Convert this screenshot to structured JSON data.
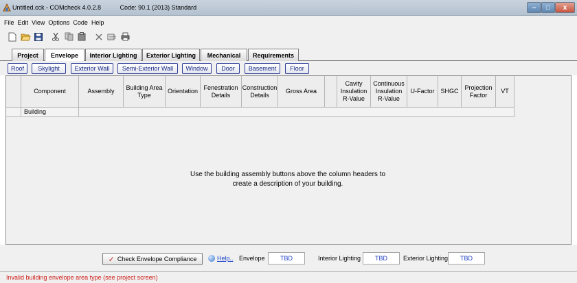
{
  "window": {
    "title": "Untitled.cck - COMcheck 4.0.2.8",
    "code_label": "Code: 90.1 (2013) Standard",
    "minimize_glyph": "–",
    "maximize_glyph": "□",
    "close_glyph": "x"
  },
  "menu": [
    "File",
    "Edit",
    "View",
    "Options",
    "Code",
    "Help"
  ],
  "toolbar": [
    "new-icon",
    "open-icon",
    "save-icon",
    "cut-icon",
    "copy-icon",
    "paste-icon",
    "delete-icon",
    "edit-icon",
    "print-icon"
  ],
  "tabs": [
    "Project",
    "Envelope",
    "Interior Lighting",
    "Exterior Lighting",
    "Mechanical",
    "Requirements"
  ],
  "active_tab": "Envelope",
  "assembly_buttons": [
    "Roof",
    "Skylight",
    "Exterior Wall",
    "Semi-Exterior Wall",
    "Window",
    "Door",
    "Basement",
    "Floor"
  ],
  "table": {
    "headers": [
      "",
      "Component",
      "Assembly",
      "Building Area Type",
      "Orientation",
      "Fenestration Details",
      "Construction Details",
      "Gross Area",
      "",
      "Cavity Insulation R-Value",
      "Continuous Insulation R-Value",
      "U-Factor",
      "SHGC",
      "Projection Factor",
      "VT"
    ],
    "rows": [
      [
        "",
        "Building"
      ]
    ],
    "empty_message": "Use the building assembly buttons above the column headers to create a description of your building."
  },
  "compliance": {
    "check_button": "Check Envelope Compliance",
    "help_link": "Help..",
    "envelope_label": "Envelope",
    "envelope_value": "TBD",
    "interior_label": "Interior Lighting",
    "interior_value": "TBD",
    "exterior_label": "Exterior Lighting",
    "exterior_value": "TBD"
  },
  "status": "Invalid building envelope area type (see project screen)",
  "colors": {
    "status_error": "#d0201a",
    "link": "#1a44c9",
    "assembly_text": "#1a2a8a"
  }
}
